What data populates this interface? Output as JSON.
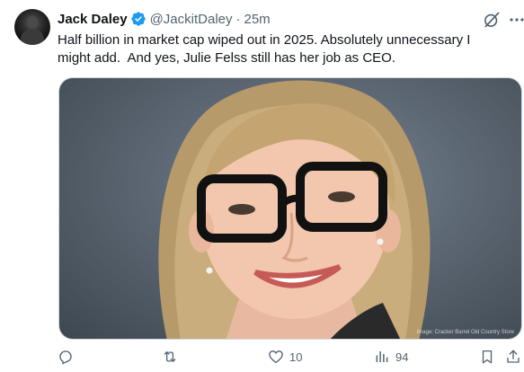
{
  "author": {
    "name": "Jack Daley",
    "handle": "@JackitDaley",
    "separator": "·",
    "time": "25m",
    "verified_color": "#1d9bf0"
  },
  "post": {
    "text": "Half billion in market cap wiped out in 2025. Absolutely unnecessary I\nmight add.  And yes, Julie Felss still has her job as CEO."
  },
  "media": {
    "credit": "Image: Cracker Barrel Old Country Store"
  },
  "actions": {
    "reply_count": "",
    "repost_count": "",
    "like_count": "10",
    "views_count": "94"
  },
  "icons": {
    "grok": "grok-icon",
    "more": "more-icon",
    "reply": "reply-icon",
    "repost": "repost-icon",
    "like": "heart-icon",
    "views": "views-icon",
    "bookmark": "bookmark-icon",
    "share": "share-icon"
  }
}
